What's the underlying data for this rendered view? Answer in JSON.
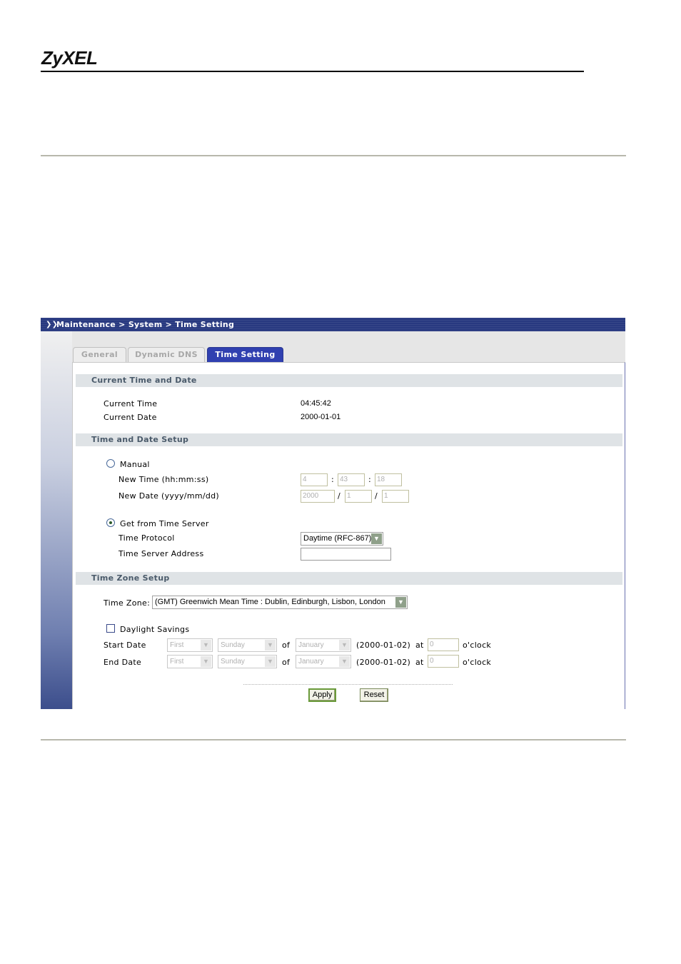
{
  "brand": {
    "logo": "ZyXEL"
  },
  "screenshot": {
    "breadcrumb": "Maintenance > System > Time Setting",
    "tabs": [
      {
        "label": "General",
        "active": false
      },
      {
        "label": "Dynamic DNS",
        "active": false
      },
      {
        "label": "Time Setting",
        "active": true
      }
    ],
    "current": {
      "header": "Current Time and Date",
      "time_label": "Current Time",
      "time_value": "04:45:42",
      "date_label": "Current Date",
      "date_value": "2000-01-01"
    },
    "setup": {
      "header": "Time and Date Setup",
      "manual_label": "Manual",
      "manual_selected": false,
      "new_time_label": "New Time (hh:mm:ss)",
      "new_time": {
        "hh": "4",
        "mm": "43",
        "ss": "18"
      },
      "new_date_label": "New Date (yyyy/mm/dd)",
      "new_date": {
        "yyyy": "2000",
        "mm": "1",
        "dd": "1"
      },
      "server_label": "Get from Time Server",
      "server_selected": true,
      "protocol_label": "Time Protocol",
      "protocol_value": "Daytime (RFC-867)",
      "address_label": "Time Server Address",
      "address_value": ""
    },
    "timezone": {
      "header": "Time Zone Setup",
      "zone_label": "Time Zone:",
      "zone_value": "(GMT) Greenwich Mean Time : Dublin, Edinburgh, Lisbon, London",
      "daylight_label": "Daylight Savings",
      "daylight_checked": false,
      "start": {
        "label": "Start Date",
        "week": "First",
        "day": "Sunday",
        "of": "of",
        "month": "January",
        "date": "(2000-01-02)",
        "at": "at",
        "hour": "0",
        "oclock": "o'clock"
      },
      "end": {
        "label": "End Date",
        "week": "First",
        "day": "Sunday",
        "of": "of",
        "month": "January",
        "date": "(2000-01-02)",
        "at": "at",
        "hour": "0",
        "oclock": "o'clock"
      }
    },
    "buttons": {
      "apply": "Apply",
      "reset": "Reset"
    }
  },
  "icons": {
    "breadcrumb_arrow": "double-chevron-right-icon",
    "dropdown": "chevron-down-icon"
  },
  "colors": {
    "title_bar": "#283980",
    "active_tab": "#3040b0",
    "section_header": "#dfe3e6"
  }
}
